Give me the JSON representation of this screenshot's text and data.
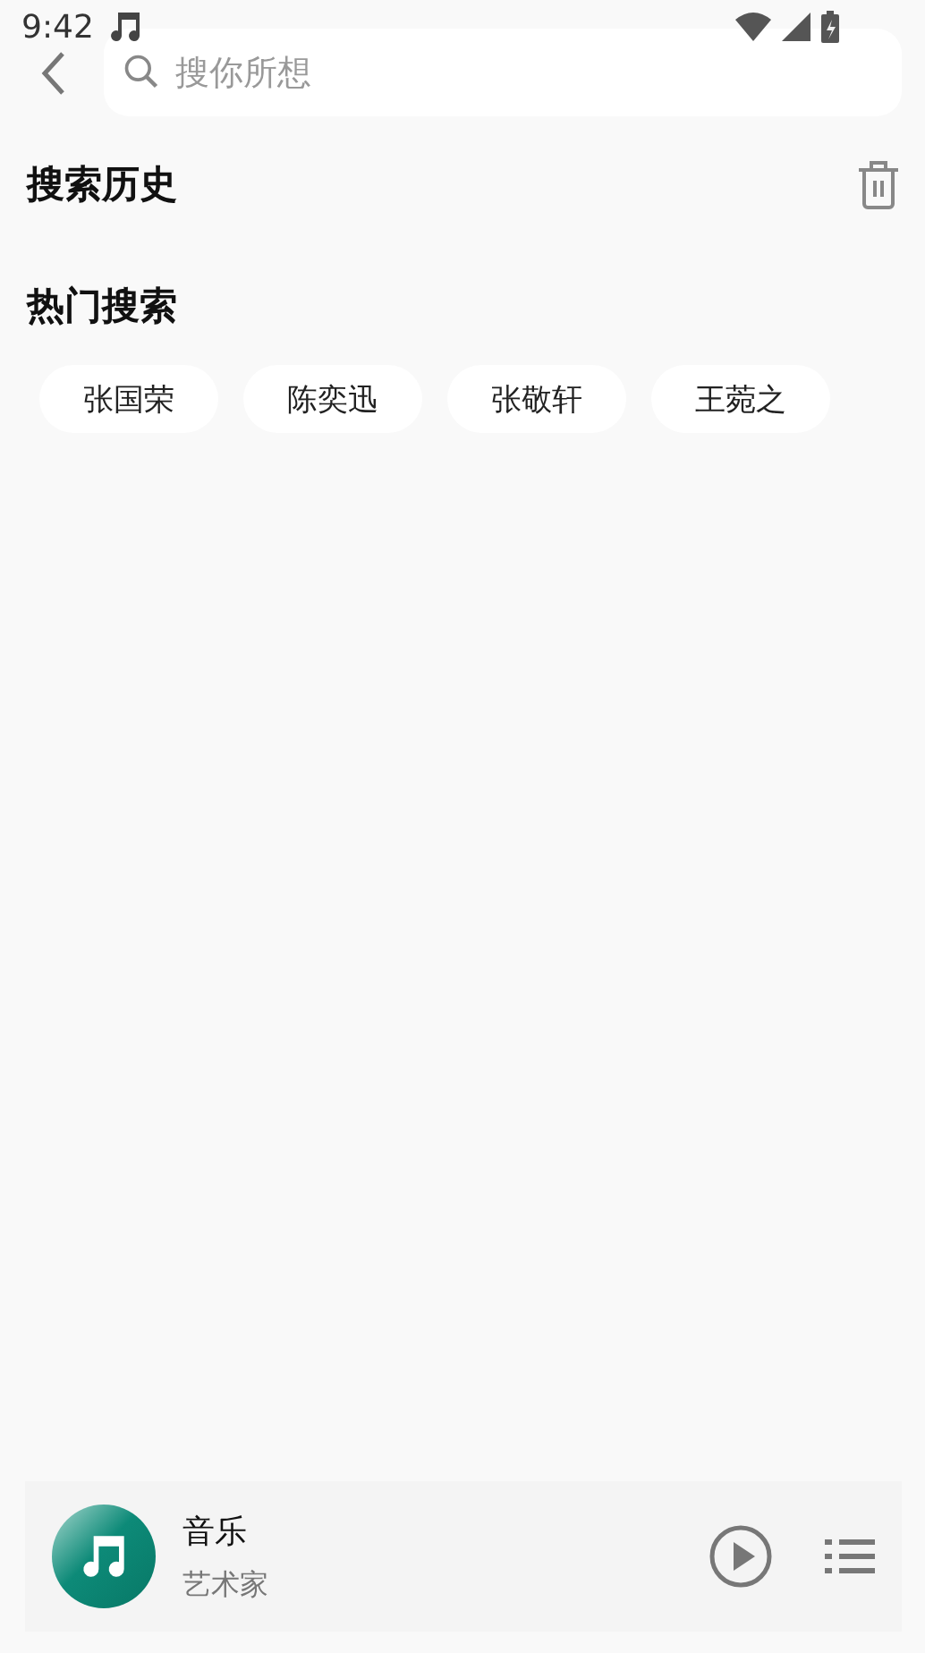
{
  "status_bar": {
    "time": "9:42"
  },
  "search": {
    "placeholder": "搜你所想"
  },
  "history": {
    "title": "搜索历史"
  },
  "hot": {
    "title": "热门搜索",
    "tags": [
      "张国荣",
      "陈奕迅",
      "张敬轩",
      "王菀之"
    ]
  },
  "player": {
    "title": "音乐",
    "artist": "艺术家",
    "playing": false
  }
}
